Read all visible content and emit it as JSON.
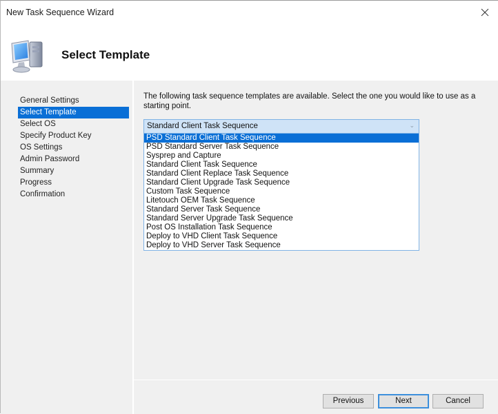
{
  "window": {
    "title": "New Task Sequence Wizard",
    "close_icon": "close-icon"
  },
  "header": {
    "icon": "computer-icon",
    "title": "Select Template"
  },
  "sidebar": {
    "items": [
      {
        "label": "General Settings",
        "active": false
      },
      {
        "label": "Select Template",
        "active": true
      },
      {
        "label": "Select OS",
        "active": false
      },
      {
        "label": "Specify Product Key",
        "active": false
      },
      {
        "label": "OS Settings",
        "active": false
      },
      {
        "label": "Admin Password",
        "active": false
      },
      {
        "label": "Summary",
        "active": false
      },
      {
        "label": "Progress",
        "active": false
      },
      {
        "label": "Confirmation",
        "active": false
      }
    ]
  },
  "content": {
    "instructions": "The following task sequence templates are available.  Select the one you would like to use as a starting point.",
    "template_select": {
      "value": "Standard Client Task Sequence",
      "arrow_icon": "chevron-down-icon",
      "highlighted_option": "PSD Standard Client Task Sequence",
      "options": [
        "PSD Standard Client Task Sequence",
        "PSD Standard Server Task Sequence",
        "Sysprep and Capture",
        "Standard Client Task Sequence",
        "Standard Client Replace Task Sequence",
        "Standard Client Upgrade Task Sequence",
        "Custom Task Sequence",
        "Litetouch OEM Task Sequence",
        "Standard Server Task Sequence",
        "Standard Server Upgrade Task Sequence",
        "Post OS Installation Task Sequence",
        "Deploy to VHD Client Task Sequence",
        "Deploy to VHD Server Task Sequence"
      ]
    }
  },
  "buttons": {
    "previous": "Previous",
    "next": "Next",
    "cancel": "Cancel"
  },
  "colors": {
    "selection": "#0a6fd6",
    "combo_background": "#cfe3f7",
    "combo_border": "#7fb2e5",
    "default_button_border": "#3c8fdc",
    "panel_background": "#f0f0f0"
  }
}
